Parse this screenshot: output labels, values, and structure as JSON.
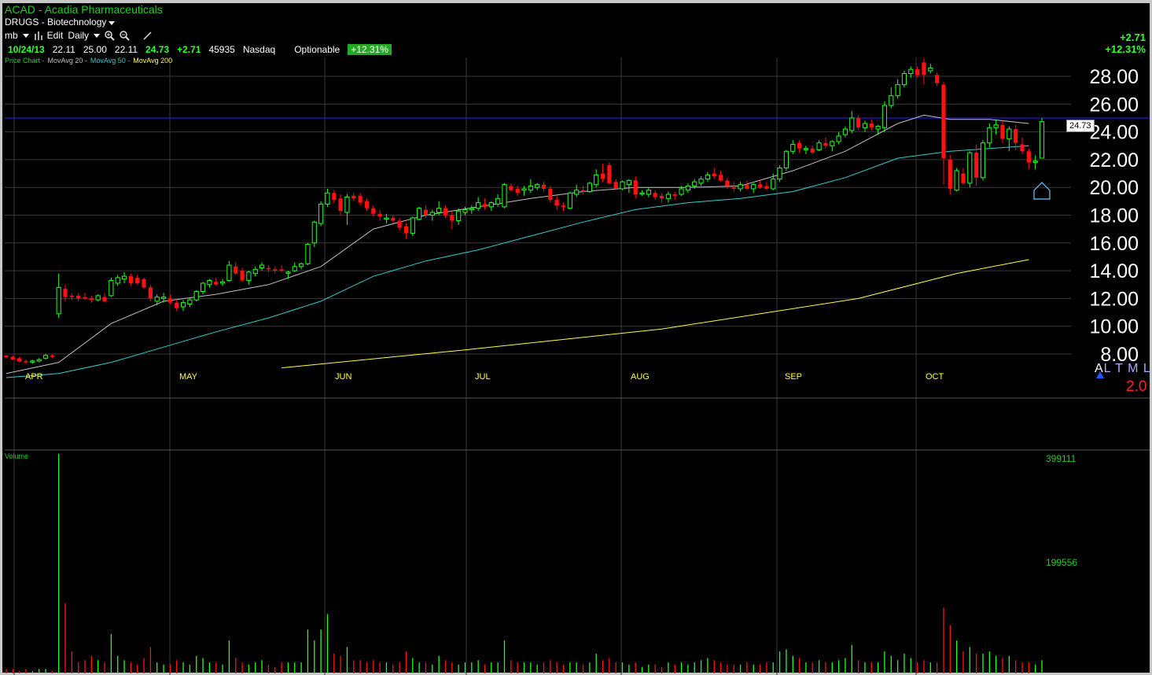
{
  "header": {
    "title": "ACAD - Acadia Pharmaceuticals",
    "subtitle": "DRUGS - Biotechnology"
  },
  "toolbar": {
    "user": "mb",
    "edit": "Edit",
    "period": "Daily"
  },
  "quote": {
    "date": "10/24/13",
    "open": "22.11",
    "high": "25.00",
    "low": "22.11",
    "close": "24.73",
    "change": "+2.71",
    "volume": "45935",
    "exchange": "Nasdaq",
    "optionable": "Optionable",
    "pct": "+12.31%"
  },
  "legend": {
    "price_chart": "Price Chart -",
    "ma20": "MovAvg 20 -",
    "ma50": "MovAvg 50 -",
    "ma200": "MovAvg 200"
  },
  "right_change": {
    "change": "+2.71",
    "pct": "+12.31%"
  },
  "current_price": "24.73",
  "al": {
    "a": "A",
    "rest": "L T M L"
  },
  "tm_value": "2.0",
  "volume": {
    "label": "Volume",
    "tick_high": "399111",
    "tick_mid": "199556"
  },
  "colors": {
    "up": "#22ff22",
    "down": "#ff1111",
    "ma20": "#c0c0c0",
    "ma50": "#33cccc",
    "ma200": "#ffff44",
    "hline": "#2222ff"
  },
  "chart_data": {
    "type": "candlestick",
    "y_ticks": [
      "28.00",
      "26.00",
      "24.00",
      "22.00",
      "20.00",
      "18.00",
      "16.00",
      "14.00",
      "12.00",
      "10.00",
      "8.00"
    ],
    "ylim": [
      7.5,
      29.5
    ],
    "months": [
      "APR",
      "MAY",
      "JUN",
      "JUL",
      "AUG",
      "SEP",
      "OCT"
    ],
    "candles": [
      [
        7.9,
        7.9,
        7.7,
        7.75
      ],
      [
        7.8,
        7.9,
        7.6,
        7.6
      ],
      [
        7.7,
        7.8,
        7.4,
        7.45
      ],
      [
        7.5,
        7.6,
        7.3,
        7.4
      ],
      [
        7.45,
        7.6,
        7.3,
        7.5
      ],
      [
        7.5,
        7.7,
        7.4,
        7.6
      ],
      [
        7.7,
        8.0,
        7.6,
        7.9
      ],
      [
        7.9,
        8.0,
        7.7,
        7.8
      ],
      [
        10.9,
        13.8,
        10.6,
        12.8
      ],
      [
        12.7,
        13.0,
        11.8,
        12.1
      ],
      [
        12.2,
        12.4,
        11.9,
        12.1
      ],
      [
        12.2,
        12.4,
        11.8,
        12.0
      ],
      [
        12.1,
        12.4,
        11.9,
        12.0
      ],
      [
        12.0,
        12.2,
        11.7,
        11.9
      ],
      [
        11.9,
        12.3,
        11.8,
        12.2
      ],
      [
        12.1,
        12.4,
        11.7,
        11.8
      ],
      [
        12.2,
        13.5,
        12.1,
        13.3
      ],
      [
        13.1,
        13.7,
        12.9,
        13.5
      ],
      [
        13.4,
        13.9,
        13.1,
        13.6
      ],
      [
        13.6,
        13.8,
        12.9,
        13.1
      ],
      [
        13.5,
        13.7,
        13.0,
        13.1
      ],
      [
        13.4,
        13.5,
        12.7,
        12.8
      ],
      [
        12.8,
        13.0,
        11.8,
        12.0
      ],
      [
        11.8,
        12.3,
        11.5,
        12.1
      ],
      [
        12.0,
        12.4,
        11.7,
        12.1
      ],
      [
        12.0,
        12.3,
        11.6,
        11.7
      ],
      [
        11.7,
        11.9,
        11.1,
        11.3
      ],
      [
        11.4,
        11.9,
        11.1,
        11.7
      ],
      [
        11.6,
        12.0,
        11.4,
        11.9
      ],
      [
        11.9,
        12.6,
        11.8,
        12.5
      ],
      [
        12.5,
        13.2,
        12.3,
        13.1
      ],
      [
        13.0,
        13.4,
        12.8,
        13.3
      ],
      [
        13.2,
        13.5,
        12.9,
        13.0
      ],
      [
        13.1,
        13.4,
        12.9,
        13.2
      ],
      [
        13.3,
        14.7,
        13.2,
        14.4
      ],
      [
        14.3,
        14.6,
        13.7,
        13.8
      ],
      [
        14.0,
        14.2,
        13.2,
        13.3
      ],
      [
        13.3,
        14.0,
        13.0,
        13.9
      ],
      [
        13.8,
        14.3,
        13.6,
        14.1
      ],
      [
        14.2,
        14.6,
        14.0,
        14.4
      ],
      [
        14.2,
        14.4,
        13.9,
        14.1
      ],
      [
        14.1,
        14.3,
        13.8,
        14.0
      ],
      [
        14.1,
        14.4,
        13.9,
        14.0
      ],
      [
        13.9,
        14.0,
        13.4,
        13.9
      ],
      [
        14.0,
        14.6,
        13.9,
        14.3
      ],
      [
        14.3,
        14.6,
        14.1,
        14.5
      ],
      [
        14.5,
        16.0,
        14.4,
        15.9
      ],
      [
        16.0,
        17.6,
        15.7,
        17.5
      ],
      [
        17.4,
        19.0,
        17.2,
        18.8
      ],
      [
        18.8,
        19.9,
        18.6,
        19.6
      ],
      [
        19.6,
        19.8,
        18.9,
        19.1
      ],
      [
        19.2,
        19.5,
        18.0,
        18.3
      ],
      [
        18.2,
        19.5,
        17.3,
        19.3
      ],
      [
        19.4,
        19.6,
        19.0,
        19.2
      ],
      [
        19.4,
        19.6,
        18.7,
        18.9
      ],
      [
        19.0,
        19.2,
        18.3,
        18.5
      ],
      [
        18.5,
        18.7,
        17.9,
        18.1
      ],
      [
        18.1,
        18.4,
        17.6,
        17.9
      ],
      [
        17.8,
        18.1,
        17.4,
        17.8
      ],
      [
        17.8,
        18.0,
        17.4,
        17.6
      ],
      [
        17.6,
        17.8,
        16.9,
        17.1
      ],
      [
        17.2,
        17.4,
        16.3,
        16.7
      ],
      [
        16.7,
        17.9,
        16.5,
        17.8
      ],
      [
        17.7,
        18.6,
        17.6,
        18.5
      ],
      [
        18.4,
        18.7,
        17.8,
        18.0
      ],
      [
        18.0,
        18.4,
        17.6,
        18.2
      ],
      [
        18.2,
        19.0,
        18.0,
        18.5
      ],
      [
        18.5,
        18.7,
        17.8,
        18.0
      ],
      [
        18.0,
        18.3,
        17.0,
        17.6
      ],
      [
        17.6,
        18.5,
        17.3,
        18.3
      ],
      [
        18.2,
        18.6,
        18.0,
        18.4
      ],
      [
        18.4,
        18.7,
        18.1,
        18.5
      ],
      [
        18.5,
        19.3,
        18.3,
        18.9
      ],
      [
        18.8,
        19.2,
        18.4,
        18.6
      ],
      [
        18.6,
        19.0,
        18.3,
        18.9
      ],
      [
        18.8,
        19.5,
        18.6,
        19.2
      ],
      [
        18.6,
        20.3,
        18.5,
        20.2
      ],
      [
        20.1,
        20.3,
        19.7,
        19.8
      ],
      [
        19.9,
        20.1,
        19.4,
        19.6
      ],
      [
        19.8,
        20.1,
        19.4,
        19.9
      ],
      [
        19.8,
        20.6,
        19.6,
        20.1
      ],
      [
        20.0,
        20.3,
        19.8,
        20.2
      ],
      [
        20.2,
        20.4,
        19.7,
        19.9
      ],
      [
        19.9,
        20.1,
        18.9,
        19.1
      ],
      [
        19.1,
        19.4,
        18.4,
        18.7
      ],
      [
        18.7,
        18.9,
        18.3,
        18.6
      ],
      [
        18.5,
        19.7,
        18.4,
        19.6
      ],
      [
        19.5,
        20.2,
        19.3,
        19.8
      ],
      [
        19.8,
        20.1,
        19.5,
        19.7
      ],
      [
        19.7,
        20.4,
        19.6,
        20.3
      ],
      [
        20.2,
        21.3,
        20.0,
        20.9
      ],
      [
        21.0,
        21.7,
        20.4,
        20.6
      ],
      [
        21.6,
        21.8,
        20.2,
        20.3
      ],
      [
        20.4,
        20.6,
        19.8,
        19.9
      ],
      [
        19.9,
        20.5,
        19.8,
        20.4
      ],
      [
        20.2,
        20.6,
        19.6,
        20.5
      ],
      [
        20.5,
        20.8,
        19.2,
        19.5
      ],
      [
        19.6,
        19.8,
        19.4,
        19.6
      ],
      [
        19.5,
        20.0,
        19.3,
        19.8
      ],
      [
        19.6,
        19.8,
        19.1,
        19.3
      ],
      [
        19.4,
        19.6,
        18.9,
        19.2
      ],
      [
        19.2,
        19.7,
        18.9,
        19.5
      ],
      [
        19.5,
        19.7,
        19.1,
        19.4
      ],
      [
        19.5,
        20.1,
        19.4,
        19.9
      ],
      [
        19.8,
        20.3,
        19.6,
        20.1
      ],
      [
        20.1,
        20.6,
        19.9,
        20.4
      ],
      [
        20.3,
        20.8,
        20.1,
        20.6
      ],
      [
        20.6,
        21.1,
        20.4,
        20.9
      ],
      [
        21.0,
        21.4,
        20.6,
        20.8
      ],
      [
        20.9,
        21.2,
        20.4,
        20.5
      ],
      [
        20.5,
        20.7,
        19.9,
        20.1
      ],
      [
        20.0,
        20.4,
        19.7,
        19.9
      ],
      [
        19.9,
        20.4,
        19.7,
        20.2
      ],
      [
        20.2,
        20.5,
        19.8,
        19.9
      ],
      [
        19.9,
        20.3,
        19.6,
        20.2
      ],
      [
        20.2,
        20.5,
        19.9,
        20.0
      ],
      [
        20.1,
        20.4,
        19.8,
        19.9
      ],
      [
        19.9,
        21.0,
        19.8,
        20.6
      ],
      [
        20.6,
        21.6,
        20.4,
        21.4
      ],
      [
        21.4,
        22.7,
        21.2,
        22.6
      ],
      [
        22.6,
        23.4,
        22.4,
        23.1
      ],
      [
        23.2,
        23.4,
        22.5,
        22.8
      ],
      [
        22.8,
        23.0,
        22.4,
        22.8
      ],
      [
        22.8,
        23.0,
        22.4,
        22.5
      ],
      [
        22.7,
        23.4,
        22.6,
        23.2
      ],
      [
        23.2,
        23.6,
        22.8,
        23.0
      ],
      [
        23.0,
        23.4,
        22.6,
        23.3
      ],
      [
        23.3,
        24.0,
        23.1,
        23.7
      ],
      [
        23.8,
        24.4,
        23.6,
        24.2
      ],
      [
        24.1,
        25.5,
        23.9,
        25.0
      ],
      [
        25.0,
        25.2,
        24.1,
        24.3
      ],
      [
        24.3,
        24.8,
        24.0,
        24.6
      ],
      [
        24.6,
        24.9,
        24.1,
        24.3
      ],
      [
        24.2,
        24.5,
        23.8,
        24.4
      ],
      [
        24.3,
        26.2,
        24.0,
        25.9
      ],
      [
        25.9,
        27.2,
        25.7,
        26.6
      ],
      [
        26.6,
        27.8,
        26.4,
        27.4
      ],
      [
        27.4,
        28.4,
        27.2,
        28.2
      ],
      [
        28.2,
        28.7,
        27.9,
        28.5
      ],
      [
        28.5,
        28.7,
        27.9,
        28.1
      ],
      [
        29.0,
        29.3,
        27.4,
        28.1
      ],
      [
        28.4,
        28.9,
        28.2,
        28.6
      ],
      [
        28.1,
        28.3,
        27.3,
        27.5
      ],
      [
        27.4,
        27.6,
        20.2,
        22.1
      ],
      [
        22.0,
        22.3,
        19.5,
        19.9
      ],
      [
        19.8,
        21.4,
        19.7,
        21.2
      ],
      [
        21.0,
        21.4,
        20.2,
        20.3
      ],
      [
        20.3,
        22.6,
        20.0,
        22.5
      ],
      [
        22.5,
        23.1,
        20.1,
        20.7
      ],
      [
        20.7,
        23.4,
        20.5,
        23.2
      ],
      [
        23.2,
        24.6,
        22.9,
        24.3
      ],
      [
        24.3,
        24.9,
        23.8,
        24.5
      ],
      [
        24.5,
        24.8,
        23.2,
        23.5
      ],
      [
        23.5,
        24.4,
        22.6,
        24.2
      ],
      [
        24.2,
        24.5,
        22.7,
        23.2
      ],
      [
        23.1,
        23.6,
        22.4,
        22.6
      ],
      [
        22.6,
        22.8,
        21.3,
        21.8
      ],
      [
        21.8,
        22.3,
        21.3,
        21.9
      ],
      [
        22.11,
        25.0,
        22.11,
        24.73
      ]
    ],
    "ma20": [
      [
        0,
        6.6
      ],
      [
        8,
        7.4
      ],
      [
        16,
        10.2
      ],
      [
        24,
        11.8
      ],
      [
        32,
        12.3
      ],
      [
        40,
        13.0
      ],
      [
        48,
        14.3
      ],
      [
        56,
        17.0
      ],
      [
        64,
        18.0
      ],
      [
        72,
        18.6
      ],
      [
        80,
        19.2
      ],
      [
        88,
        19.7
      ],
      [
        96,
        20.0
      ],
      [
        104,
        20.0
      ],
      [
        112,
        20.1
      ],
      [
        120,
        21.2
      ],
      [
        128,
        22.6
      ],
      [
        136,
        24.6
      ],
      [
        140,
        25.2
      ],
      [
        144,
        24.9
      ],
      [
        150,
        24.9
      ],
      [
        156,
        24.6
      ]
    ],
    "ma50": [
      [
        0,
        6.3
      ],
      [
        8,
        6.6
      ],
      [
        16,
        7.4
      ],
      [
        24,
        8.5
      ],
      [
        32,
        9.6
      ],
      [
        40,
        10.6
      ],
      [
        48,
        11.8
      ],
      [
        56,
        13.6
      ],
      [
        64,
        14.7
      ],
      [
        72,
        15.5
      ],
      [
        80,
        16.5
      ],
      [
        88,
        17.5
      ],
      [
        96,
        18.4
      ],
      [
        104,
        18.9
      ],
      [
        112,
        19.2
      ],
      [
        120,
        19.7
      ],
      [
        128,
        20.7
      ],
      [
        136,
        22.1
      ],
      [
        144,
        22.6
      ],
      [
        150,
        22.8
      ],
      [
        156,
        23.0
      ]
    ],
    "ma200": [
      [
        42,
        7.0
      ],
      [
        70,
        8.3
      ],
      [
        100,
        9.8
      ],
      [
        130,
        12.0
      ],
      [
        145,
        13.8
      ],
      [
        156,
        14.8
      ]
    ],
    "hline": 25.0,
    "volume": [
      0.02,
      0.02,
      0.01,
      0.02,
      0.01,
      0.02,
      0.02,
      0.01,
      1.0,
      0.32,
      0.1,
      0.05,
      0.06,
      0.08,
      0.06,
      0.05,
      0.18,
      0.08,
      0.06,
      0.05,
      0.04,
      0.07,
      0.12,
      0.05,
      0.04,
      0.04,
      0.06,
      0.05,
      0.04,
      0.08,
      0.07,
      0.05,
      0.05,
      0.04,
      0.15,
      0.07,
      0.05,
      0.04,
      0.05,
      0.06,
      0.04,
      0.03,
      0.05,
      0.05,
      0.05,
      0.05,
      0.2,
      0.15,
      0.2,
      0.27,
      0.09,
      0.08,
      0.12,
      0.06,
      0.06,
      0.05,
      0.06,
      0.05,
      0.05,
      0.04,
      0.05,
      0.1,
      0.07,
      0.05,
      0.05,
      0.04,
      0.08,
      0.06,
      0.05,
      0.04,
      0.05,
      0.05,
      0.06,
      0.04,
      0.05,
      0.05,
      0.15,
      0.06,
      0.05,
      0.05,
      0.05,
      0.04,
      0.05,
      0.06,
      0.05,
      0.04,
      0.05,
      0.05,
      0.04,
      0.05,
      0.09,
      0.06,
      0.07,
      0.05,
      0.05,
      0.04,
      0.05,
      0.03,
      0.04,
      0.04,
      0.03,
      0.05,
      0.04,
      0.05,
      0.04,
      0.05,
      0.06,
      0.07,
      0.06,
      0.05,
      0.04,
      0.04,
      0.04,
      0.05,
      0.04,
      0.04,
      0.05,
      0.05,
      0.1,
      0.11,
      0.08,
      0.07,
      0.05,
      0.05,
      0.06,
      0.05,
      0.05,
      0.06,
      0.07,
      0.13,
      0.06,
      0.05,
      0.05,
      0.05,
      0.1,
      0.08,
      0.06,
      0.09,
      0.07,
      0.05,
      0.06,
      0.05,
      0.05,
      0.3,
      0.22,
      0.15,
      0.1,
      0.12,
      0.09,
      0.09,
      0.1,
      0.08,
      0.07,
      0.08,
      0.06,
      0.05,
      0.05,
      0.04,
      0.06
    ]
  }
}
